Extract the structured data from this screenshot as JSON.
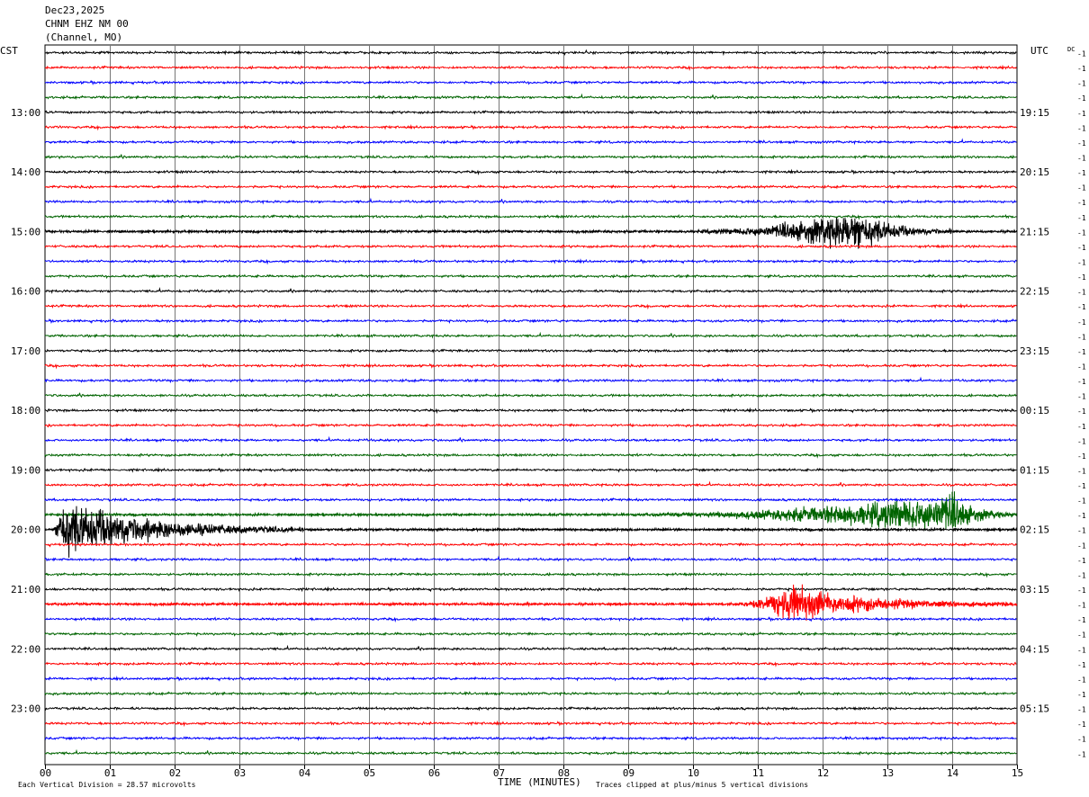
{
  "header": {
    "date": "Dec23,2025",
    "station": "CHNM EHZ NM 00",
    "channel": "(Channel, MO)"
  },
  "left_axis_title": "CST",
  "right_axis_title": "UTC",
  "dc_label": "DC",
  "footer": {
    "division_text": "Each Vertical Division =   28.57 microvolts",
    "xlabel": "TIME (MINUTES)",
    "clip_text": "Traces clipped at plus/minus 5 vertical divisions"
  },
  "trace_colors": [
    "#000000",
    "#ff0000",
    "#0000ff",
    "#006400"
  ],
  "chart_data": {
    "type": "line",
    "title": "CHNM EHZ NM 00",
    "xlabel": "TIME (MINUTES)",
    "xlim": [
      0,
      15
    ],
    "x_ticks": [
      "00",
      "01",
      "02",
      "03",
      "04",
      "05",
      "06",
      "07",
      "08",
      "09",
      "10",
      "11",
      "12",
      "13",
      "14",
      "15"
    ],
    "rows": 48,
    "minutes_per_row": 15,
    "left_ticks": [
      {
        "row": 4,
        "label": "13:00"
      },
      {
        "row": 8,
        "label": "14:00"
      },
      {
        "row": 12,
        "label": "15:00"
      },
      {
        "row": 16,
        "label": "16:00"
      },
      {
        "row": 20,
        "label": "17:00"
      },
      {
        "row": 24,
        "label": "18:00"
      },
      {
        "row": 28,
        "label": "19:00"
      },
      {
        "row": 32,
        "label": "20:00"
      },
      {
        "row": 36,
        "label": "21:00"
      },
      {
        "row": 40,
        "label": "22:00"
      },
      {
        "row": 44,
        "label": "23:00"
      }
    ],
    "right_ticks": [
      {
        "row": 4,
        "label": "19:15"
      },
      {
        "row": 8,
        "label": "20:15"
      },
      {
        "row": 12,
        "label": "21:15"
      },
      {
        "row": 16,
        "label": "22:15"
      },
      {
        "row": 20,
        "label": "23:15"
      },
      {
        "row": 24,
        "label": "00:15"
      },
      {
        "row": 28,
        "label": "01:15"
      },
      {
        "row": 32,
        "label": "02:15"
      },
      {
        "row": 36,
        "label": "03:15"
      },
      {
        "row": 40,
        "label": "04:15"
      },
      {
        "row": 44,
        "label": "05:15"
      }
    ],
    "dc_offset_label": "-1",
    "events": [
      {
        "row": 12,
        "start_min": 9.5,
        "peak_min": 12.6,
        "end_min": 14.0,
        "peak_divisions": 1.5
      },
      {
        "row": 31,
        "start_min": 8.5,
        "peak_min": 14.0,
        "end_min": 15.0,
        "peak_divisions": 1.5
      },
      {
        "row": 32,
        "start_min": 0.1,
        "peak_min": 0.25,
        "end_min": 4.0,
        "peak_divisions": 2.3
      },
      {
        "row": 37,
        "start_min": 10.5,
        "peak_min": 11.5,
        "end_min": 15.0,
        "peak_divisions": 1.4
      }
    ]
  }
}
